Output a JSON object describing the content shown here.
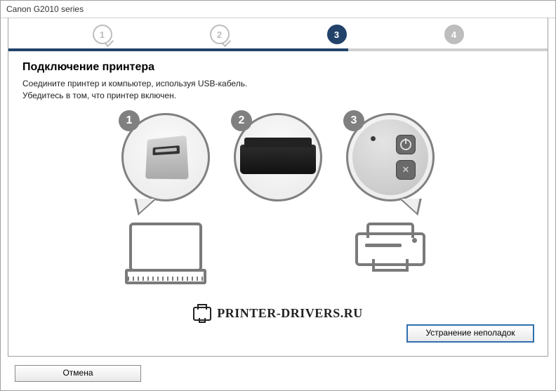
{
  "window": {
    "title": "Canon G2010 series"
  },
  "steps": {
    "items": [
      {
        "label": "1",
        "state": "done"
      },
      {
        "label": "2",
        "state": "done"
      },
      {
        "label": "3",
        "state": "active"
      },
      {
        "label": "4",
        "state": "future"
      }
    ],
    "progress_percent": 63
  },
  "heading": "Подключение принтера",
  "description_line1": "Соедините принтер и компьютер, используя USB-кабель.",
  "description_line2": "Убедитесь в том, что принтер включен.",
  "illustrations": {
    "badges": {
      "usb": "1",
      "printer": "2",
      "power": "3"
    }
  },
  "watermark": "PRINTER-DRIVERS.RU",
  "buttons": {
    "troubleshoot": "Устранение неполадок",
    "cancel": "Отмена"
  }
}
